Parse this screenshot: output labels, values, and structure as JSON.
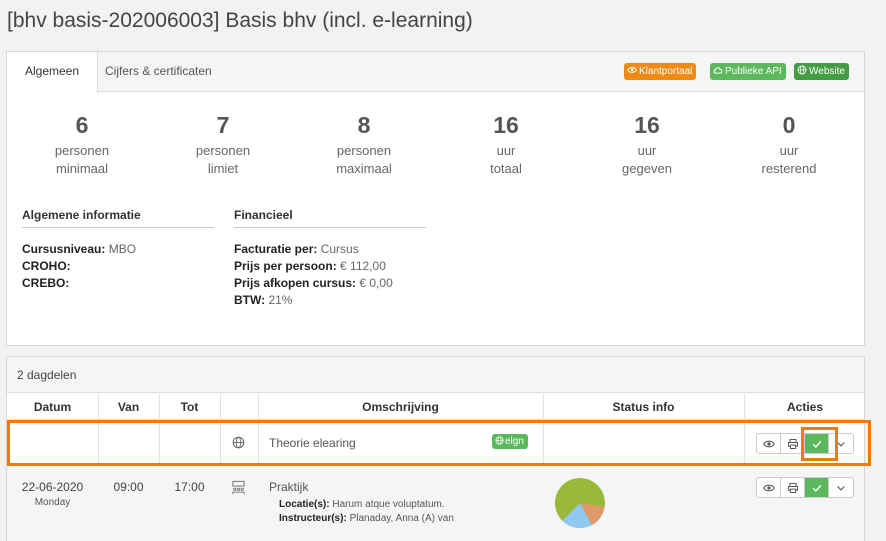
{
  "page": {
    "title": "[bhv basis-202006003] Basis bhv (incl. e-learning)"
  },
  "tabs": [
    {
      "label": "Algemeen",
      "active": true
    },
    {
      "label": "Cijfers & certificaten",
      "active": false
    }
  ],
  "links": {
    "klantportaal": "Klantportaal",
    "publieke_api": "Publieke API",
    "website": "Website"
  },
  "stats": [
    {
      "value": "6",
      "line1": "personen",
      "line2": "minimaal"
    },
    {
      "value": "7",
      "line1": "personen",
      "line2": "limiet"
    },
    {
      "value": "8",
      "line1": "personen",
      "line2": "maximaal"
    },
    {
      "value": "16",
      "line1": "uur",
      "line2": "totaal"
    },
    {
      "value": "16",
      "line1": "uur",
      "line2": "gegeven"
    },
    {
      "value": "0",
      "line1": "uur",
      "line2": "resterend"
    }
  ],
  "algemeen": {
    "heading": "Algemene informatie",
    "rows": [
      {
        "label": "Cursusniveau:",
        "value": "MBO"
      },
      {
        "label": "CROHO:",
        "value": ""
      },
      {
        "label": "CREBO:",
        "value": ""
      }
    ]
  },
  "financieel": {
    "heading": "Financieel",
    "rows": [
      {
        "label": "Facturatie per:",
        "value": "Cursus"
      },
      {
        "label": "Prijs per persoon:",
        "value": "€ 112,00"
      },
      {
        "label": "Prijs afkopen cursus:",
        "value": "€ 0,00"
      },
      {
        "label": "BTW:",
        "value": "21%"
      }
    ]
  },
  "dagdelen": {
    "heading": "2 dagdelen",
    "columns": [
      "Datum",
      "Van",
      "Tot",
      "",
      "Omschrijving",
      "Status info",
      "Acties"
    ],
    "rows": [
      {
        "date": "",
        "weekday": "",
        "van": "",
        "tot": "",
        "type_icon": "globe-icon",
        "title": "Theorie elearing",
        "tag": "elgn",
        "locatie_label": "",
        "locatie": "",
        "instructeur_label": "",
        "instructeur": ""
      },
      {
        "date": "22-06-2020",
        "weekday": "Monday",
        "van": "09:00",
        "tot": "17:00",
        "type_icon": "classroom-icon",
        "title": "Praktijk",
        "tag": "",
        "locatie_label": "Locatie(s):",
        "locatie": "Harum atque voluptatum.",
        "instructeur_label": "Instructeur(s):",
        "instructeur": "Planaday, Anna (A) van"
      }
    ]
  },
  "colors": {
    "orange": "#ee8b14",
    "green": "#5cb85c",
    "dark_green": "#449d44",
    "highlight": "#ef7b10",
    "pie_green": "#9ab93a",
    "pie_blue": "#8fc9f0",
    "pie_orange": "#e09a6a"
  }
}
